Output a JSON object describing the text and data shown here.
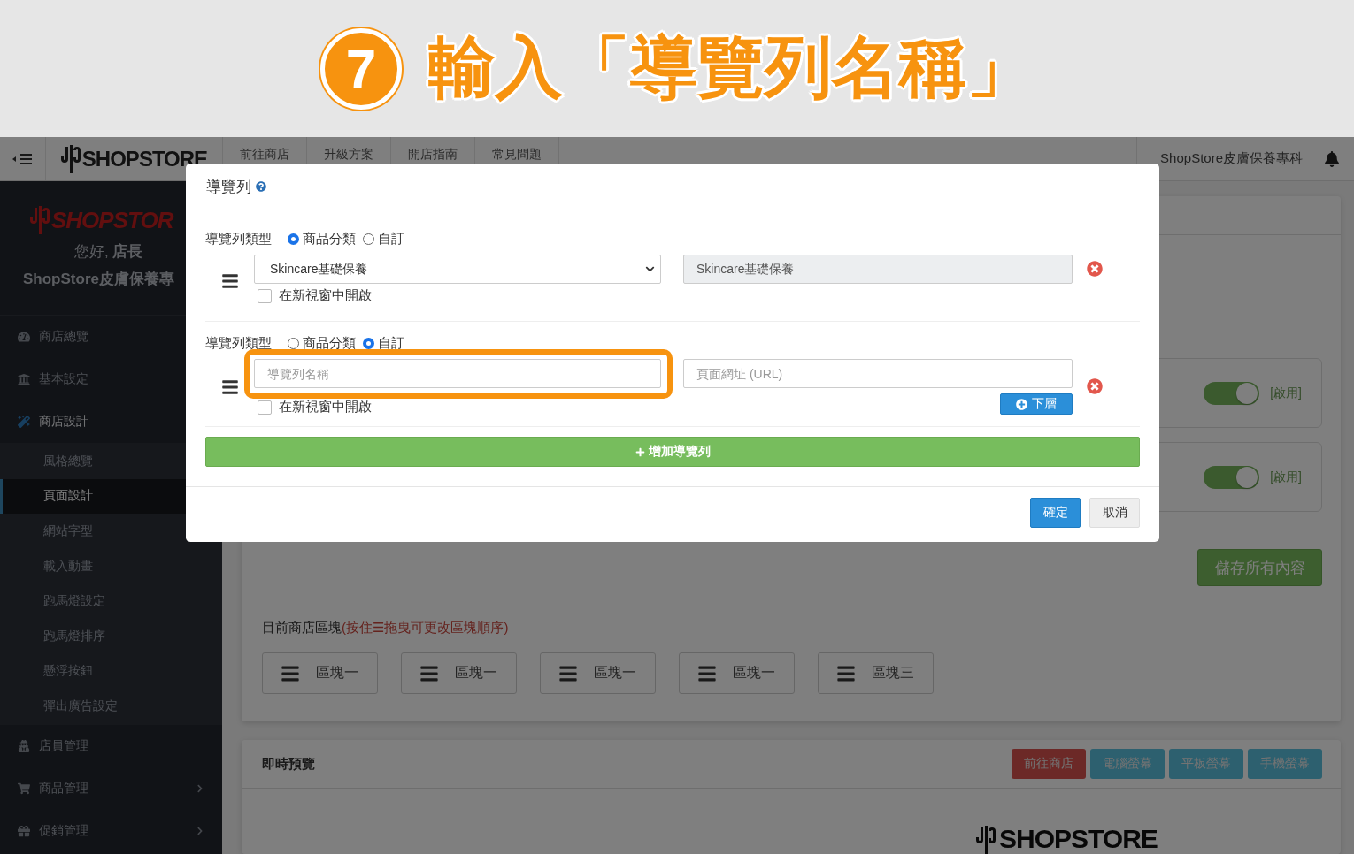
{
  "banner": {
    "step": "7",
    "title": "輸入「導覽列名稱」"
  },
  "topbar": {
    "logo": "SHOPSTORE",
    "nav": [
      "前往商店",
      "升級方案",
      "開店指南",
      "常見問題"
    ],
    "store_name": "ShopStore皮膚保養專科"
  },
  "sidebar": {
    "logo": "SHOPSTOR",
    "greeting": "您好, **店長**",
    "store_name": "ShopStore皮膚保養專",
    "items": [
      {
        "label": "商店總覽",
        "kind": "link"
      },
      {
        "label": "基本設定",
        "kind": "link"
      },
      {
        "label": "商店設計",
        "kind": "group",
        "expanded": true,
        "children": [
          {
            "label": "風格總覽",
            "selected": false
          },
          {
            "label": "頁面設計",
            "selected": true
          },
          {
            "label": "網站字型",
            "selected": false
          },
          {
            "label": "載入動畫",
            "selected": false
          },
          {
            "label": "跑馬燈設定",
            "selected": false
          },
          {
            "label": "跑馬燈排序",
            "selected": false
          },
          {
            "label": "懸浮按鈕",
            "selected": false
          },
          {
            "label": "彈出廣告設定",
            "selected": false
          }
        ]
      },
      {
        "label": "店員管理",
        "kind": "link"
      },
      {
        "label": "商品管理",
        "kind": "group",
        "expanded": false
      },
      {
        "label": "促銷管理",
        "kind": "group",
        "expanded": false
      }
    ]
  },
  "main": {
    "toggles": [
      {
        "on": true,
        "label": "[啟用]"
      },
      {
        "on": true,
        "label": "[啟用]"
      }
    ],
    "save_button": "儲存所有內容",
    "blocks_heading": "目前商店區塊",
    "blocks_hint": "(按住☰拖曳可更改區塊順序)",
    "blocks": [
      "區塊一",
      "區塊一",
      "區塊一",
      "區塊一",
      "區塊三"
    ],
    "preview": {
      "title": "即時預覽",
      "buttons": [
        {
          "label": "前往商店",
          "kind": "danger"
        },
        {
          "label": "電腦螢幕",
          "kind": "info"
        },
        {
          "label": "平板螢幕",
          "kind": "info"
        },
        {
          "label": "手機螢幕",
          "kind": "info"
        }
      ],
      "logo": "SHOPSTORE"
    }
  },
  "modal": {
    "title": "導覽列",
    "rows": [
      {
        "kind": "category",
        "type_label": "導覽列類型",
        "options": [
          {
            "label": "商品分類",
            "selected": true
          },
          {
            "label": "自訂",
            "selected": false
          }
        ],
        "select_value": "Skincare基礎保養",
        "display_value": "Skincare基礎保養",
        "new_window": {
          "label": "在新視窗中開啟",
          "checked": false
        }
      },
      {
        "kind": "custom",
        "type_label": "導覽列類型",
        "options": [
          {
            "label": "商品分類",
            "selected": false
          },
          {
            "label": "自訂",
            "selected": true
          }
        ],
        "name_placeholder": "導覽列名稱",
        "url_placeholder": "頁面網址 (URL)",
        "sublevel_button": "下層",
        "highlighted": true,
        "new_window": {
          "label": "在新視窗中開啟",
          "checked": false
        }
      }
    ],
    "add_button": "增加導覽列",
    "footer_buttons": [
      {
        "label": "確定",
        "kind": "primary"
      },
      {
        "label": "取消",
        "kind": "default"
      }
    ]
  }
}
